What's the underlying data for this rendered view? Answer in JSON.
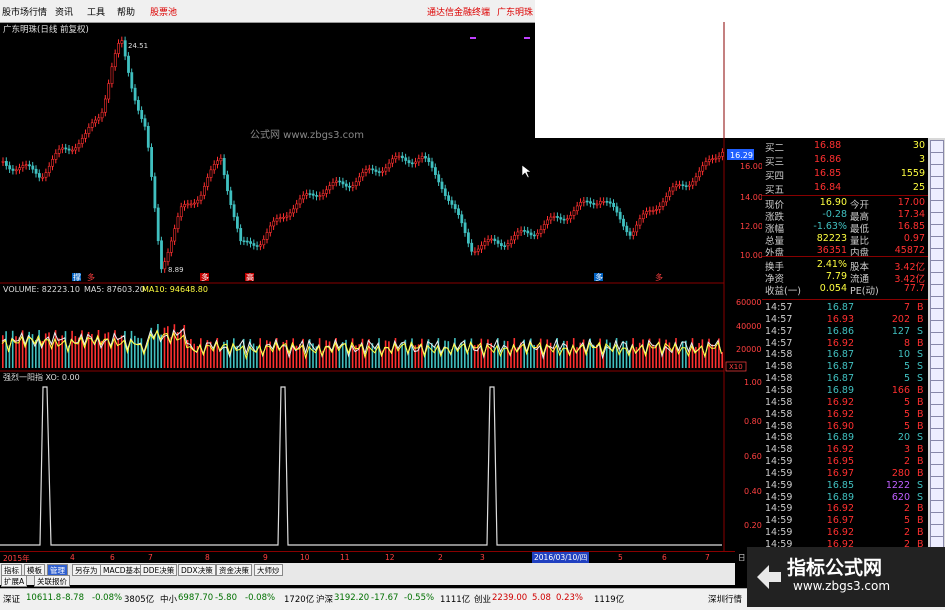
{
  "menu": {
    "items": [
      "股市场行情",
      "资讯",
      "工具",
      "帮助",
      "股票池"
    ],
    "right_items": [
      "通达信金融终端",
      "广东明珠"
    ]
  },
  "chart": {
    "title": "广东明珠(日线 前复权)",
    "high_label": "24.51",
    "low_label": "8.89",
    "current_price_tag": "16.29",
    "price_ticks": [
      "16.00",
      "14.00",
      "12.00",
      "10.00"
    ],
    "markers": [
      "撑",
      "多",
      "高",
      "多",
      "多"
    ],
    "watermark_text": "公式网 www.zbgs3.com",
    "volume_label": "VOLUME: 82223.10",
    "ma5_label": "MA5: 87603.20",
    "ma10_label": "MA10: 94648.80",
    "volume_ticks": [
      "60000",
      "40000",
      "20000"
    ],
    "volume_unit": "X10",
    "indicator_label": "强烈一阳指 XO: 0.00",
    "indicator_ticks": [
      "1.00",
      "0.80",
      "0.60",
      "0.40",
      "0.20"
    ],
    "date_labels": [
      "2015年",
      "4",
      "6",
      "7",
      "8",
      "9",
      "10",
      "11",
      "12",
      "2",
      "3",
      "2016/03/10/四",
      "5",
      "6",
      "7",
      "日"
    ]
  },
  "tabs": [
    "指标",
    "模板",
    "管理",
    "另存为",
    "MACD基本",
    "DDE决策",
    "DDX决策",
    "资金决策",
    "大师炒"
  ],
  "bottom_tabs": [
    "扩展A",
    "关联报价"
  ],
  "quote": {
    "bids": [
      {
        "label": "买二",
        "price": "16.88",
        "vol": "30"
      },
      {
        "label": "买三",
        "price": "16.86",
        "vol": "3"
      },
      {
        "label": "买四",
        "price": "16.85",
        "vol": "1559"
      },
      {
        "label": "买五",
        "price": "16.84",
        "vol": "25"
      }
    ],
    "stats": [
      {
        "l1": "现价",
        "v1": "16.90",
        "l2": "今开",
        "v2": "17.00"
      },
      {
        "l1": "涨跌",
        "v1": "-0.28",
        "l2": "最高",
        "v2": "17.34"
      },
      {
        "l1": "涨幅",
        "v1": "-1.63%",
        "l2": "最低",
        "v2": "16.85"
      },
      {
        "l1": "总量",
        "v1": "82223",
        "l2": "量比",
        "v2": "0.97"
      },
      {
        "l1": "外盘",
        "v1": "36351",
        "l2": "内盘",
        "v2": "45872"
      },
      {
        "l1": "换手",
        "v1": "2.41%",
        "l2": "股本",
        "v2": "3.42亿"
      },
      {
        "l1": "净资",
        "v1": "7.79",
        "l2": "流通",
        "v2": "3.42亿"
      },
      {
        "l1": "收益(一)",
        "v1": "0.054",
        "l2": "PE(动)",
        "v2": "77.7"
      }
    ],
    "ticks": [
      {
        "time": "14:57",
        "price": "16.87",
        "vol": "7",
        "side": "B"
      },
      {
        "time": "14:57",
        "price": "16.93",
        "vol": "202",
        "side": "B"
      },
      {
        "time": "14:57",
        "price": "16.86",
        "vol": "127",
        "side": "S"
      },
      {
        "time": "14:57",
        "price": "16.92",
        "vol": "8",
        "side": "B"
      },
      {
        "time": "14:58",
        "price": "16.87",
        "vol": "10",
        "side": "S"
      },
      {
        "time": "14:58",
        "price": "16.87",
        "vol": "5",
        "side": "S"
      },
      {
        "time": "14:58",
        "price": "16.87",
        "vol": "5",
        "side": "S"
      },
      {
        "time": "14:58",
        "price": "16.89",
        "vol": "166",
        "side": "B"
      },
      {
        "time": "14:58",
        "price": "16.92",
        "vol": "5",
        "side": "B"
      },
      {
        "time": "14:58",
        "price": "16.92",
        "vol": "5",
        "side": "B"
      },
      {
        "time": "14:58",
        "price": "16.90",
        "vol": "5",
        "side": "B"
      },
      {
        "time": "14:58",
        "price": "16.89",
        "vol": "20",
        "side": "S"
      },
      {
        "time": "14:58",
        "price": "16.92",
        "vol": "3",
        "side": "B"
      },
      {
        "time": "14:59",
        "price": "16.95",
        "vol": "2",
        "side": "B"
      },
      {
        "time": "14:59",
        "price": "16.97",
        "vol": "280",
        "side": "B"
      },
      {
        "time": "14:59",
        "price": "16.85",
        "vol": "1222",
        "side": "S"
      },
      {
        "time": "14:59",
        "price": "16.89",
        "vol": "620",
        "side": "S"
      },
      {
        "time": "14:59",
        "price": "16.92",
        "vol": "2",
        "side": "B"
      },
      {
        "time": "14:59",
        "price": "16.97",
        "vol": "5",
        "side": "B"
      },
      {
        "time": "14:59",
        "price": "16.92",
        "vol": "2",
        "side": "B"
      },
      {
        "time": "14:59",
        "price": "16.92",
        "vol": "2",
        "side": "B"
      }
    ]
  },
  "statusbar": {
    "items": [
      {
        "name": "深证",
        "value": "10611.8",
        "chg": "-8.78",
        "pct": "-0.08%",
        "amt": "3805亿"
      },
      {
        "name": "中小",
        "value": "6987.70",
        "chg": "-5.80",
        "pct": "-0.08%",
        "amt": "1720亿"
      },
      {
        "name": "沪深",
        "value": "3192.20",
        "chg": "-17.67",
        "pct": "-0.55%",
        "amt": "1111亿"
      },
      {
        "name": "创业",
        "value": "2239.00",
        "chg": "5.08",
        "pct": "0.23%",
        "amt": "1119亿"
      }
    ],
    "right_label": "深圳行情"
  },
  "watermark": {
    "title": "指标公式网",
    "url": "www.zbgs3.com"
  },
  "colors": {
    "up": "#ff3030",
    "down": "#40c0c0",
    "yellow": "#ffff40",
    "bg": "#000000"
  }
}
